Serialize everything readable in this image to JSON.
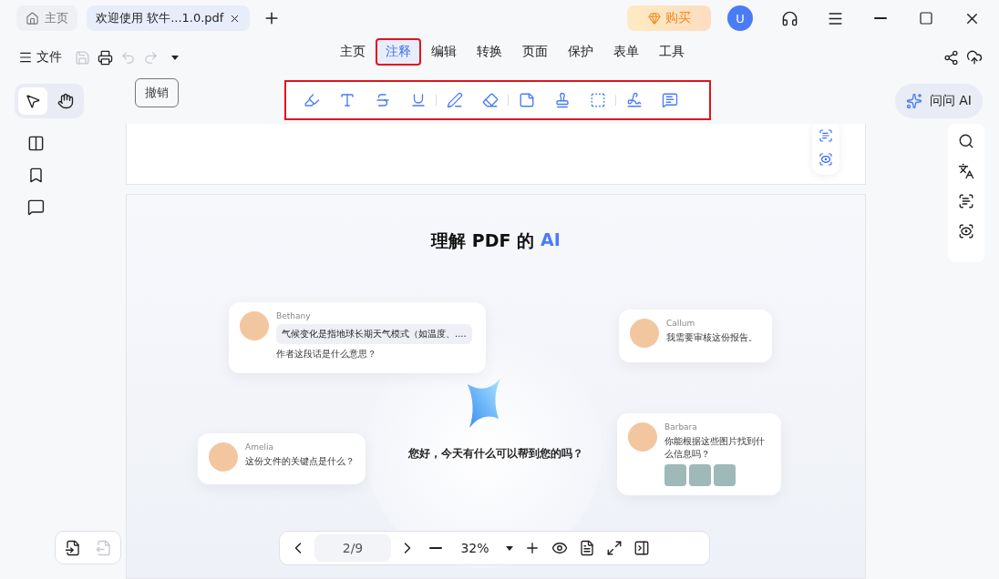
{
  "tabs": [
    {
      "label": "主页",
      "kind": "home",
      "selected": false
    },
    {
      "label": "欢迎使用 软牛...1.0.pdf",
      "kind": "doc",
      "selected": true
    }
  ],
  "buy_button": "购买",
  "avatar": "U",
  "file_menu": "文件",
  "tooltip": "撤销",
  "menu_tabs": [
    {
      "label": "主页",
      "selected": false,
      "highlighted": false
    },
    {
      "label": "注释",
      "selected": true,
      "highlighted": true
    },
    {
      "label": "编辑",
      "selected": false,
      "highlighted": false
    },
    {
      "label": "转换",
      "selected": false,
      "highlighted": false
    },
    {
      "label": "页面",
      "selected": false,
      "highlighted": false
    },
    {
      "label": "保护",
      "selected": false,
      "highlighted": false
    },
    {
      "label": "表单",
      "selected": false,
      "highlighted": false
    },
    {
      "label": "工具",
      "selected": false,
      "highlighted": false
    }
  ],
  "annotation_toolbar": {
    "highlighted": true
  },
  "tool_modes": [
    {
      "kind": "select",
      "selected": true
    },
    {
      "kind": "hand",
      "selected": false
    }
  ],
  "ask_ai_button": "问问 AI",
  "page": {
    "title": "理解 PDF 的",
    "title_accent": "AI",
    "greeting": "您好，今天有什么可以帮到您的吗？",
    "cards": [
      {
        "name": "Bethany",
        "kind": "quote",
        "quote": "气候变化是指地球长期天气模式（如温度、....",
        "text": "作者这段话是什么意思？"
      },
      {
        "name": "Callum",
        "kind": "plain",
        "text": "我需要审核这份报告。"
      },
      {
        "name": "Amelia",
        "kind": "plain",
        "text": "这份文件的关键点是什么？"
      },
      {
        "name": "Barbara",
        "kind": "images",
        "text": "你能根据这些图片找到什么信息吗？"
      }
    ]
  },
  "pager": {
    "page": "2/9",
    "zoom": "32%"
  }
}
